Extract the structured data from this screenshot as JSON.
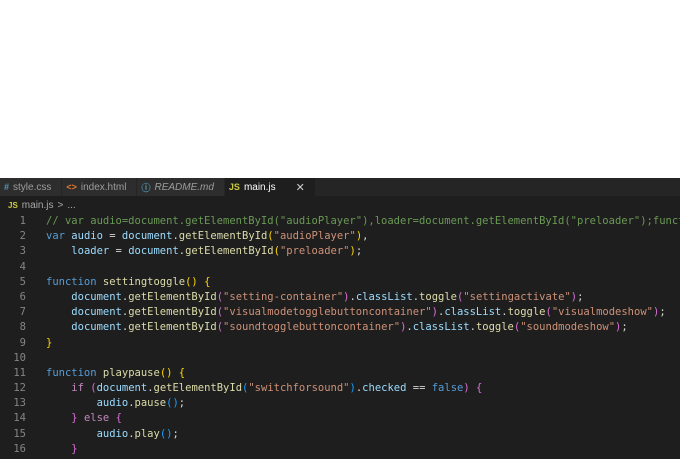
{
  "tabs": [
    {
      "icon": "#",
      "icon_color": "#519aba",
      "label": "style.css",
      "active": false,
      "italic": false
    },
    {
      "icon": "<>",
      "icon_color": "#e37933",
      "label": "index.html",
      "active": false,
      "italic": false
    },
    {
      "icon": "ⓘ",
      "icon_color": "#519aba",
      "label": "README.md",
      "active": false,
      "italic": true
    },
    {
      "icon": "JS",
      "icon_color": "#cbcb41",
      "label": "main.js",
      "active": true,
      "italic": false,
      "close": "✕"
    }
  ],
  "breadcrumb": {
    "icon": "JS",
    "file": "main.js",
    "separator": ">",
    "more": "..."
  },
  "code_lines": [
    {
      "n": "1",
      "tokens": [
        [
          "cm",
          "// var audio=document.getElementById(\"audioPlayer\"),loader=document.getElementById(\"preloader\");function"
        ]
      ]
    },
    {
      "n": "2",
      "tokens": [
        [
          "kw",
          "var"
        ],
        [
          "p",
          " "
        ],
        [
          "var",
          "audio"
        ],
        [
          "p",
          " = "
        ],
        [
          "var",
          "document"
        ],
        [
          "p",
          "."
        ],
        [
          "fn",
          "getElementById"
        ],
        [
          "br1",
          "("
        ],
        [
          "str",
          "\"audioPlayer\""
        ],
        [
          "br1",
          ")"
        ],
        [
          "p",
          ","
        ]
      ]
    },
    {
      "n": "3",
      "tokens": [
        [
          "p",
          "    "
        ],
        [
          "var",
          "loader"
        ],
        [
          "p",
          " = "
        ],
        [
          "var",
          "document"
        ],
        [
          "p",
          "."
        ],
        [
          "fn",
          "getElementById"
        ],
        [
          "br1",
          "("
        ],
        [
          "str",
          "\"preloader\""
        ],
        [
          "br1",
          ")"
        ],
        [
          "p",
          ";"
        ]
      ]
    },
    {
      "n": "4",
      "tokens": []
    },
    {
      "n": "5",
      "tokens": [
        [
          "kw",
          "function"
        ],
        [
          "p",
          " "
        ],
        [
          "fn",
          "settingtoggle"
        ],
        [
          "br1",
          "()"
        ],
        [
          "p",
          " "
        ],
        [
          "br1",
          "{"
        ]
      ]
    },
    {
      "n": "6",
      "tokens": [
        [
          "p",
          "    "
        ],
        [
          "var",
          "document"
        ],
        [
          "p",
          "."
        ],
        [
          "fn",
          "getElementById"
        ],
        [
          "br2",
          "("
        ],
        [
          "str",
          "\"setting-container\""
        ],
        [
          "br2",
          ")"
        ],
        [
          "p",
          "."
        ],
        [
          "var",
          "classList"
        ],
        [
          "p",
          "."
        ],
        [
          "fn",
          "toggle"
        ],
        [
          "br2",
          "("
        ],
        [
          "str",
          "\"settingactivate\""
        ],
        [
          "br2",
          ")"
        ],
        [
          "p",
          ";"
        ]
      ]
    },
    {
      "n": "7",
      "tokens": [
        [
          "p",
          "    "
        ],
        [
          "var",
          "document"
        ],
        [
          "p",
          "."
        ],
        [
          "fn",
          "getElementById"
        ],
        [
          "br2",
          "("
        ],
        [
          "str",
          "\"visualmodetogglebuttoncontainer\""
        ],
        [
          "br2",
          ")"
        ],
        [
          "p",
          "."
        ],
        [
          "var",
          "classList"
        ],
        [
          "p",
          "."
        ],
        [
          "fn",
          "toggle"
        ],
        [
          "br2",
          "("
        ],
        [
          "str",
          "\"visualmodeshow\""
        ],
        [
          "br2",
          ")"
        ],
        [
          "p",
          ";"
        ]
      ]
    },
    {
      "n": "8",
      "tokens": [
        [
          "p",
          "    "
        ],
        [
          "var",
          "document"
        ],
        [
          "p",
          "."
        ],
        [
          "fn",
          "getElementById"
        ],
        [
          "br2",
          "("
        ],
        [
          "str",
          "\"soundtogglebuttoncontainer\""
        ],
        [
          "br2",
          ")"
        ],
        [
          "p",
          "."
        ],
        [
          "var",
          "classList"
        ],
        [
          "p",
          "."
        ],
        [
          "fn",
          "toggle"
        ],
        [
          "br2",
          "("
        ],
        [
          "str",
          "\"soundmodeshow\""
        ],
        [
          "br2",
          ")"
        ],
        [
          "p",
          ";"
        ]
      ]
    },
    {
      "n": "9",
      "tokens": [
        [
          "br1",
          "}"
        ]
      ]
    },
    {
      "n": "10",
      "tokens": []
    },
    {
      "n": "11",
      "tokens": [
        [
          "kw",
          "function"
        ],
        [
          "p",
          " "
        ],
        [
          "fn",
          "playpause"
        ],
        [
          "br1",
          "()"
        ],
        [
          "p",
          " "
        ],
        [
          "br1",
          "{"
        ]
      ]
    },
    {
      "n": "12",
      "tokens": [
        [
          "p",
          "    "
        ],
        [
          "ctl",
          "if"
        ],
        [
          "p",
          " "
        ],
        [
          "br2",
          "("
        ],
        [
          "var",
          "document"
        ],
        [
          "p",
          "."
        ],
        [
          "fn",
          "getElementById"
        ],
        [
          "br3",
          "("
        ],
        [
          "str",
          "\"switchforsound\""
        ],
        [
          "br3",
          ")"
        ],
        [
          "p",
          "."
        ],
        [
          "var",
          "checked"
        ],
        [
          "p",
          " == "
        ],
        [
          "kw",
          "false"
        ],
        [
          "br2",
          ")"
        ],
        [
          "p",
          " "
        ],
        [
          "br2",
          "{"
        ]
      ]
    },
    {
      "n": "13",
      "tokens": [
        [
          "p",
          "        "
        ],
        [
          "var",
          "audio"
        ],
        [
          "p",
          "."
        ],
        [
          "fn",
          "pause"
        ],
        [
          "br3",
          "()"
        ],
        [
          "p",
          ";"
        ]
      ]
    },
    {
      "n": "14",
      "tokens": [
        [
          "p",
          "    "
        ],
        [
          "br2",
          "}"
        ],
        [
          "p",
          " "
        ],
        [
          "ctl",
          "else"
        ],
        [
          "p",
          " "
        ],
        [
          "br2",
          "{"
        ]
      ]
    },
    {
      "n": "15",
      "tokens": [
        [
          "p",
          "        "
        ],
        [
          "var",
          "audio"
        ],
        [
          "p",
          "."
        ],
        [
          "fn",
          "play"
        ],
        [
          "br3",
          "()"
        ],
        [
          "p",
          ";"
        ]
      ]
    },
    {
      "n": "16",
      "tokens": [
        [
          "p",
          "    "
        ],
        [
          "br2",
          "}"
        ]
      ]
    }
  ]
}
